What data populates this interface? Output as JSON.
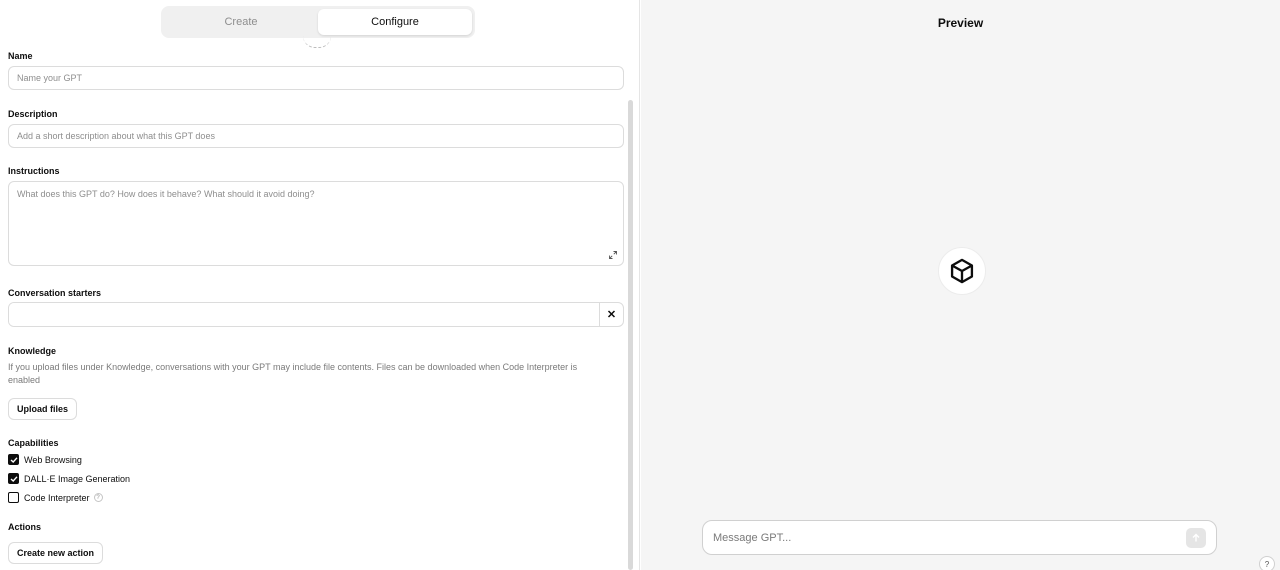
{
  "tabs": {
    "create": "Create",
    "configure": "Configure",
    "active": "Configure"
  },
  "name": {
    "label": "Name",
    "placeholder": "Name your GPT",
    "value": ""
  },
  "description": {
    "label": "Description",
    "placeholder": "Add a short description about what this GPT does",
    "value": ""
  },
  "instructions": {
    "label": "Instructions",
    "placeholder": "What does this GPT do? How does it behave? What should it avoid doing?",
    "value": ""
  },
  "starters": {
    "label": "Conversation starters",
    "value": "",
    "remove_icon": "close-icon"
  },
  "knowledge": {
    "label": "Knowledge",
    "help": "If you upload files under Knowledge, conversations with your GPT may include file contents. Files can be downloaded when Code Interpreter is enabled",
    "upload_button": "Upload files"
  },
  "capabilities": {
    "label": "Capabilities",
    "items": [
      {
        "label": "Web Browsing",
        "checked": true
      },
      {
        "label": "DALL·E Image Generation",
        "checked": true
      },
      {
        "label": "Code Interpreter",
        "checked": false,
        "info": "?"
      }
    ]
  },
  "actions": {
    "label": "Actions",
    "button": "Create new action"
  },
  "preview": {
    "title": "Preview",
    "avatar_icon": "cube-icon",
    "message_placeholder": "Message GPT...",
    "send_icon": "arrow-up-icon",
    "help": "?"
  },
  "colors": {
    "text": "#0d0d0d",
    "muted": "#8e8e8e",
    "border": "#dcdcdc",
    "preview_bg": "#f5f5f5"
  }
}
